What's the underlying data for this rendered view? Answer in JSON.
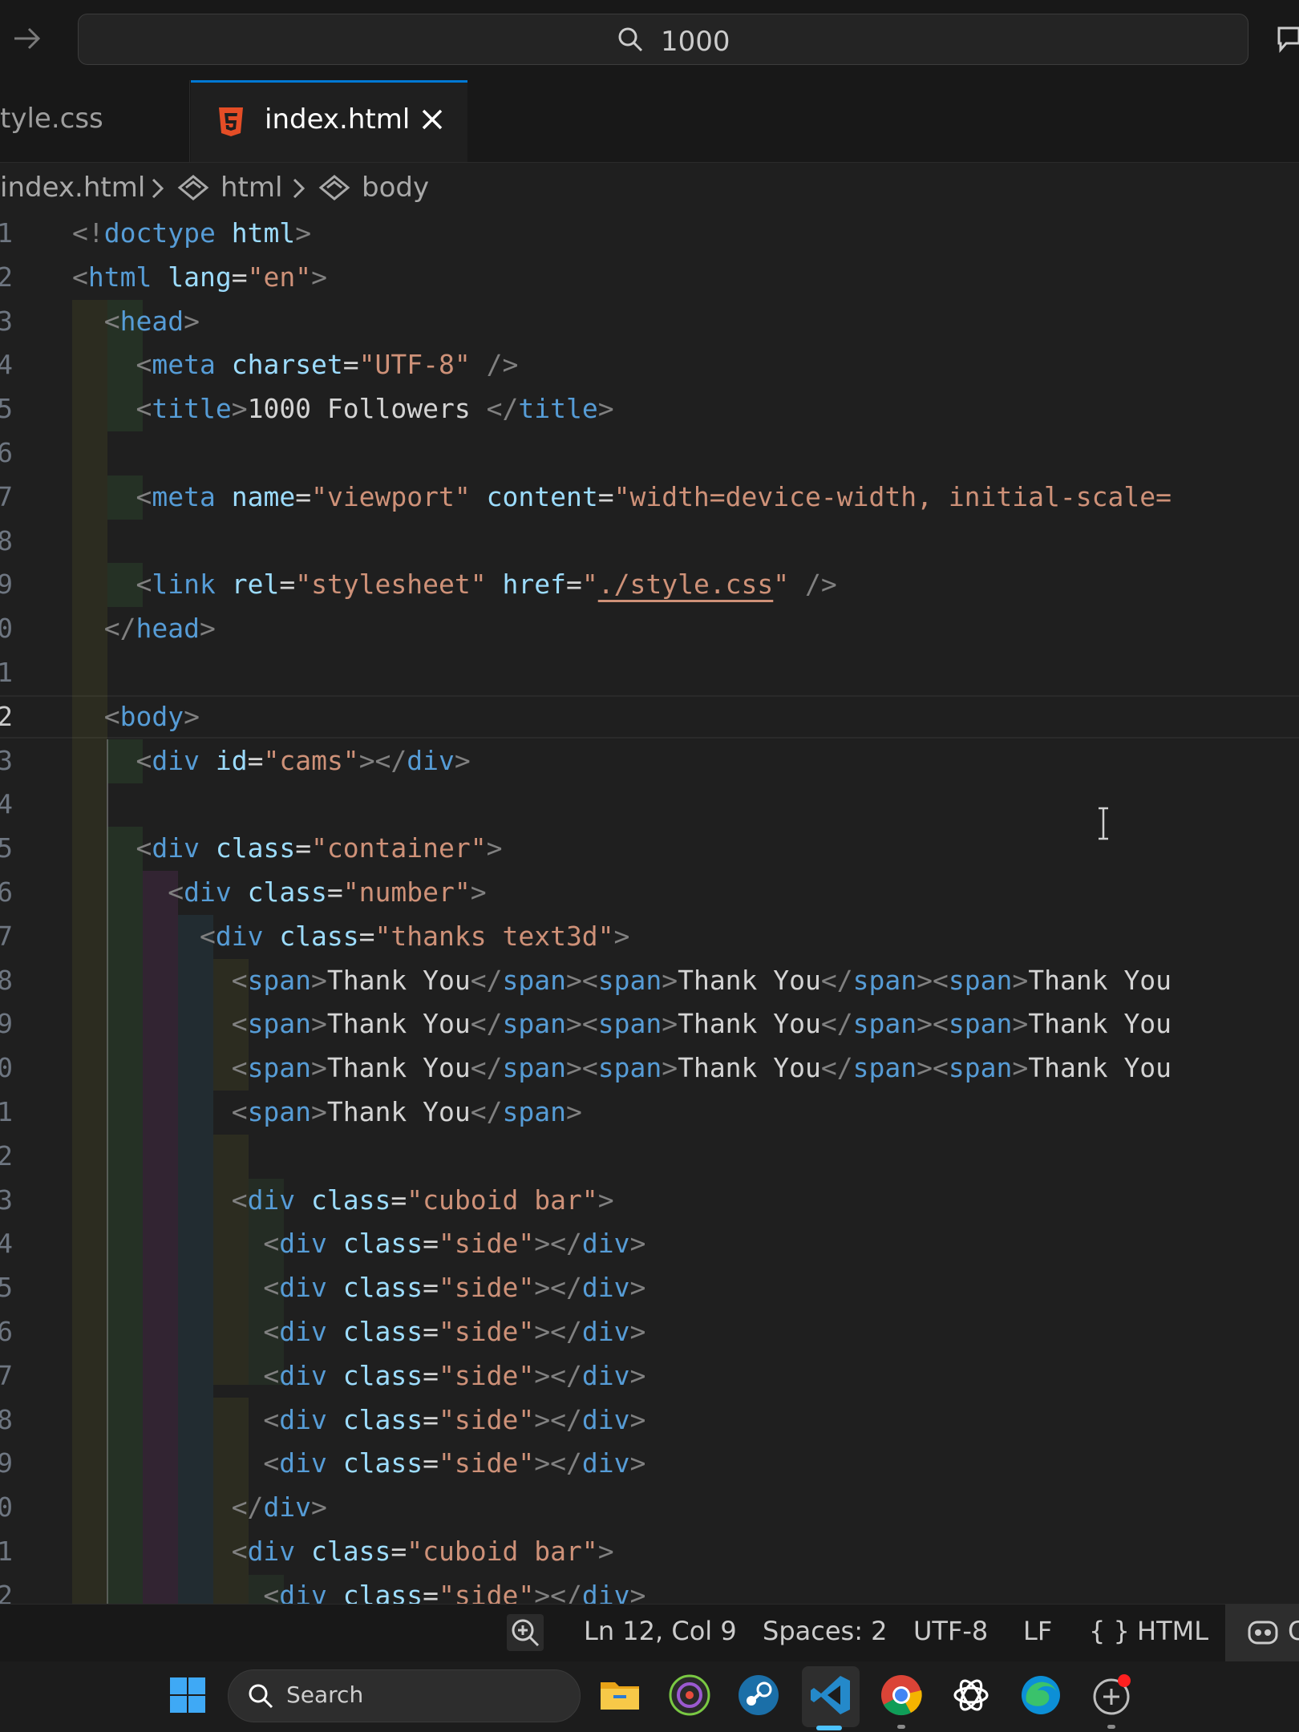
{
  "titlebar": {
    "command_center_text": "1000"
  },
  "tabs": [
    {
      "label": "tyle.css"
    },
    {
      "label": "index.html"
    }
  ],
  "breadcrumb": {
    "file": "index.html",
    "node1": "html",
    "node2": "body"
  },
  "line_numbers": [
    "1",
    "2",
    "3",
    "4",
    "5",
    "6",
    "7",
    "8",
    "9",
    "0",
    "1",
    "2",
    "3",
    "4",
    "5",
    "6",
    "7",
    "8",
    "9",
    "0",
    "1",
    "2",
    "3",
    "4",
    "5",
    "6",
    "7",
    "8",
    "9",
    "0",
    "1",
    "2"
  ],
  "active_line": 12,
  "statusbar": {
    "position": "Ln 12, Col 9",
    "spaces": "Spaces: 2",
    "encoding": "UTF-8",
    "eol": "LF",
    "language_braces": "{ }",
    "language": "HTML",
    "copilot_letter": "C"
  },
  "taskbar": {
    "search_label": "Search",
    "apps": [
      "file-explorer-icon",
      "obs-icon",
      "steam-icon",
      "vscode-icon",
      "chrome-icon",
      "chatgpt-icon",
      "edge-icon",
      "app-icon"
    ]
  },
  "colors": {
    "accent": "#0078d4",
    "tag": "#569cd6",
    "attribute": "#9cdcfe",
    "string": "#ce9178",
    "punctuation": "#808080"
  }
}
